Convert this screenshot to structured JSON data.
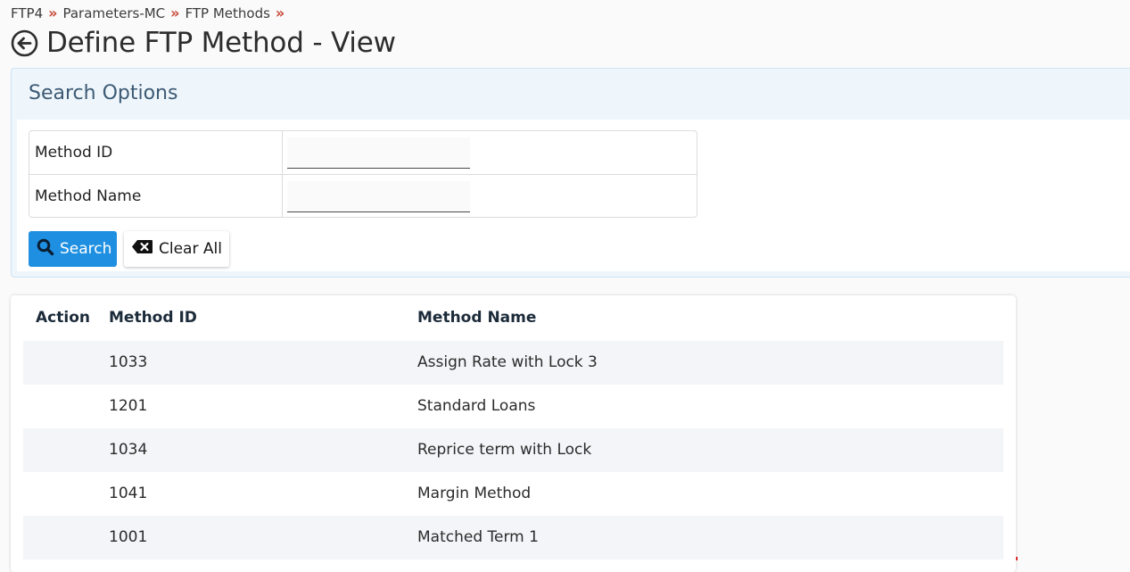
{
  "breadcrumb": {
    "items": [
      "FTP4",
      "Parameters-MC",
      "FTP Methods"
    ],
    "separator": "»"
  },
  "header": {
    "title": "Define FTP Method - View",
    "back_icon": "arrow-circle-left-icon"
  },
  "search": {
    "title": "Search Options",
    "fields": [
      {
        "label": "Method ID",
        "value": "",
        "placeholder": ""
      },
      {
        "label": "Method Name",
        "value": "",
        "placeholder": ""
      }
    ],
    "search_label": "Search",
    "search_icon": "search-icon",
    "clear_label": "Clear All",
    "clear_icon": "backspace-icon"
  },
  "results": {
    "columns": [
      "Action",
      "Method ID",
      "Method Name"
    ],
    "rows": [
      {
        "id": "1033",
        "name": "Assign Rate with Lock 3"
      },
      {
        "id": "1201",
        "name": "Standard Loans"
      },
      {
        "id": "1034",
        "name": "Reprice term with Lock"
      },
      {
        "id": "1041",
        "name": "Margin Method"
      },
      {
        "id": "1001",
        "name": "Matched Term 1"
      }
    ]
  },
  "colors": {
    "accent": "#1e8fe1",
    "breadcrumb_separator": "#c74634",
    "panel_background": "#eef6fc",
    "row_stripe": "#f4f5f8"
  }
}
